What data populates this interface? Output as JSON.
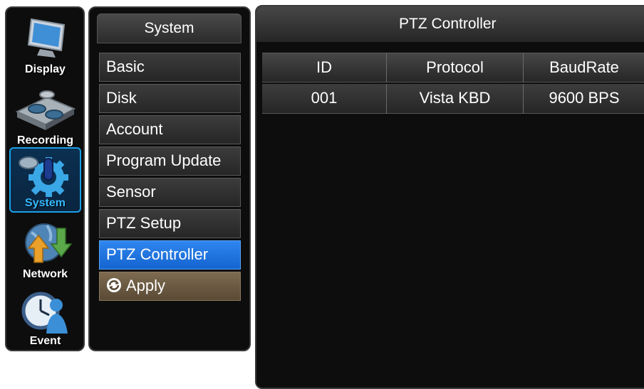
{
  "sidebar": {
    "items": [
      {
        "label": "Display",
        "icon": "monitor-icon"
      },
      {
        "label": "Recording",
        "icon": "recording-reels-icon"
      },
      {
        "label": "System",
        "icon": "system-gear-icon",
        "active": true
      },
      {
        "label": "Network",
        "icon": "network-globe-icon"
      },
      {
        "label": "Event",
        "icon": "event-clock-icon"
      }
    ]
  },
  "menu": {
    "header": "System",
    "items": [
      "Basic",
      "Disk",
      "Account",
      "Program Update",
      "Sensor",
      "PTZ Setup",
      "PTZ Controller"
    ],
    "selected": "PTZ Controller",
    "apply_label": "Apply"
  },
  "panel": {
    "title": "PTZ Controller",
    "columns": [
      "ID",
      "Protocol",
      "BaudRate"
    ],
    "rows": [
      [
        "001",
        "Vista KBD",
        "9600 BPS"
      ]
    ]
  },
  "colors": {
    "accent": "#1a7ae8",
    "active_outline": "#1aa0e8",
    "apply": "#6e5c44",
    "background": "#0d0d0d"
  }
}
